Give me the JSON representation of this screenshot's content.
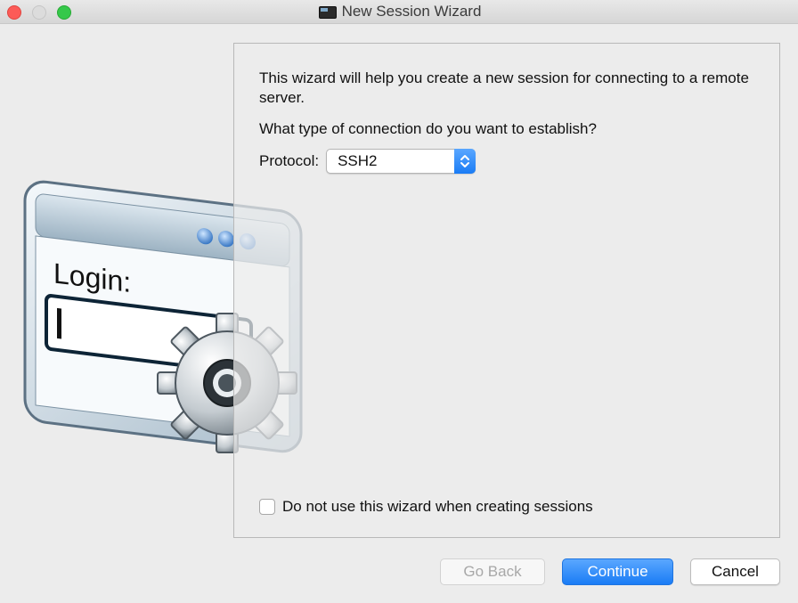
{
  "window": {
    "title": "New Session Wizard",
    "title_icon": "terminal-session-icon"
  },
  "illustration": {
    "icon": "login-window-gear-illustration",
    "login_text": "Login:"
  },
  "panel": {
    "intro": "This wizard will help you create a new session for connecting to a remote server.",
    "question": "What type of connection do you want to establish?",
    "protocol_label": "Protocol:",
    "protocol_value": "SSH2",
    "checkbox_label": "Do not use this wizard when creating sessions",
    "checkbox_checked": false
  },
  "buttons": {
    "back": "Go Back",
    "continue": "Continue",
    "cancel": "Cancel"
  },
  "colors": {
    "accent": "#1a7cf5",
    "close": "#fc5b57",
    "maximize": "#35c84a"
  }
}
